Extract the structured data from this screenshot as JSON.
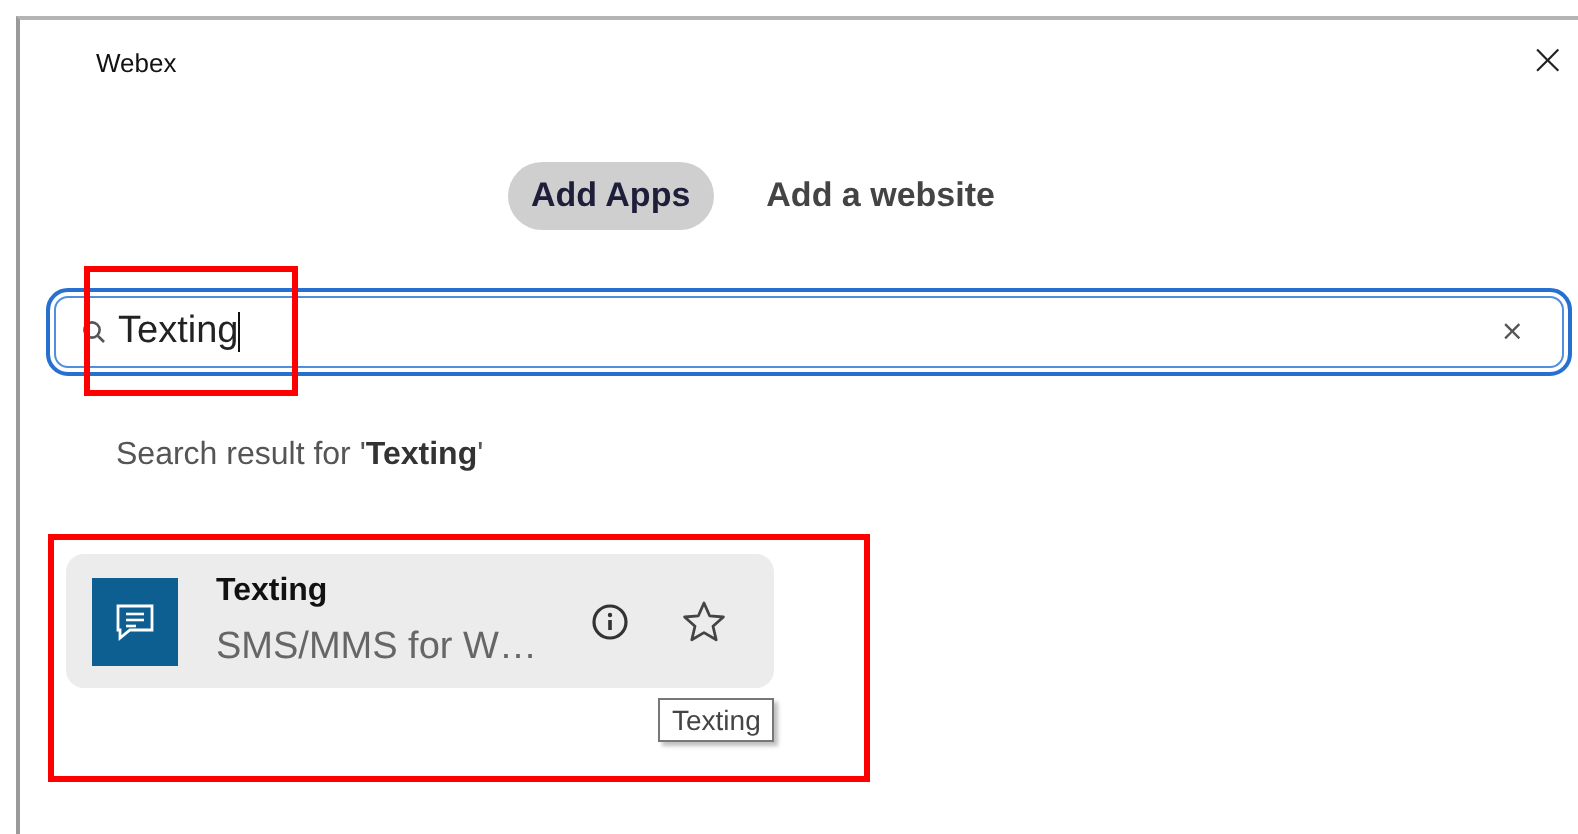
{
  "window": {
    "title": "Webex",
    "close": "×"
  },
  "tabs": [
    {
      "label": "Add Apps",
      "selected": true
    },
    {
      "label": "Add a website",
      "selected": false
    }
  ],
  "search": {
    "value": "Texting",
    "clear": "×"
  },
  "result_heading": "Search result for '**Texting**'",
  "results": [
    {
      "title": "Texting",
      "description": "SMS/MMS for W…",
      "tooltip": "Texting"
    }
  ]
}
